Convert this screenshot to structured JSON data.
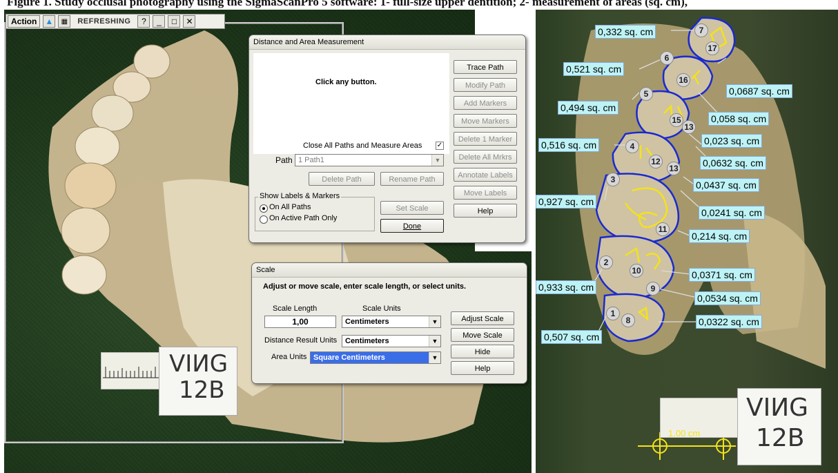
{
  "caption": {
    "text": "Figure 1. Study occlusal photography using the SigmaScanPro 5 software: 1- full-size upper dentition; 2- measurement of areas (sq. cm),"
  },
  "toolbar": {
    "action_label": "Action",
    "status": "REFRESHING",
    "help_icon": "?",
    "minimize": "_",
    "maximize": "□",
    "close": "✕"
  },
  "specimen_card": {
    "line1": "VIИG",
    "line2": "12B"
  },
  "distance_dialog": {
    "title": "Distance and Area Measurement",
    "message": "Click any button.",
    "close_paths_label": "Close All Paths and Measure Areas",
    "close_paths_checked": true,
    "path_label": "Path",
    "path_value": "1  Path1",
    "buttons": [
      "Trace Path",
      "Modify Path",
      "Add Markers",
      "Move Markers",
      "Delete 1 Marker",
      "Delete All Mrkrs",
      "Annotate Labels",
      "Move Labels",
      "Help"
    ],
    "delete_path": "Delete Path",
    "rename_path": "Rename Path",
    "set_scale": "Set Scale",
    "done": "Done",
    "show_labels_group": "Show Labels & Markers",
    "radio_all": "On All Paths",
    "radio_active": "On Active Path Only"
  },
  "scale_dialog": {
    "title": "Scale",
    "instructions": "Adjust or move scale, enter scale length, or select units.",
    "scale_length_label": "Scale Length",
    "scale_length_value": "1,00",
    "scale_units_label": "Scale Units",
    "scale_units_value": "Centimeters",
    "distance_units_label": "Distance Result Units",
    "distance_units_value": "Centimeters",
    "area_units_label": "Area Units",
    "area_units_value": "Square Centimeters",
    "buttons": [
      "Adjust Scale",
      "Move Scale",
      "Hide",
      "Help"
    ]
  },
  "right_image": {
    "areas": [
      {
        "text": "0,332 sq. cm"
      },
      {
        "text": "0,521 sq. cm"
      },
      {
        "text": "0,0687 sq. cm"
      },
      {
        "text": "0,494 sq. cm"
      },
      {
        "text": "0,058 sq. cm"
      },
      {
        "text": "0,023 sq. cm"
      },
      {
        "text": "0,516 sq. cm"
      },
      {
        "text": "0,0632 sq. cm"
      },
      {
        "text": "0,0437 sq. cm"
      },
      {
        "text": "0,927 sq. cm"
      },
      {
        "text": "0,0241 sq. cm"
      },
      {
        "text": "0,214 sq. cm"
      },
      {
        "text": "0,0371 sq. cm"
      },
      {
        "text": "0,933 sq. cm"
      },
      {
        "text": "0,0534 sq. cm"
      },
      {
        "text": "0,0322 sq. cm"
      },
      {
        "text": "0,507 sq. cm"
      }
    ],
    "markers": [
      "7",
      "17",
      "6",
      "16",
      "5",
      "15",
      "13",
      "4",
      "12",
      "13",
      "3",
      "11",
      "2",
      "10",
      "9",
      "1",
      "8"
    ],
    "scale_text": "1,00 cm",
    "card": {
      "line1": "VIИG",
      "line2": "12B"
    },
    "colors": {
      "outline": "#1a2ad0",
      "trace": "#f4e21a",
      "label_bg": "#bdf3f5"
    }
  }
}
